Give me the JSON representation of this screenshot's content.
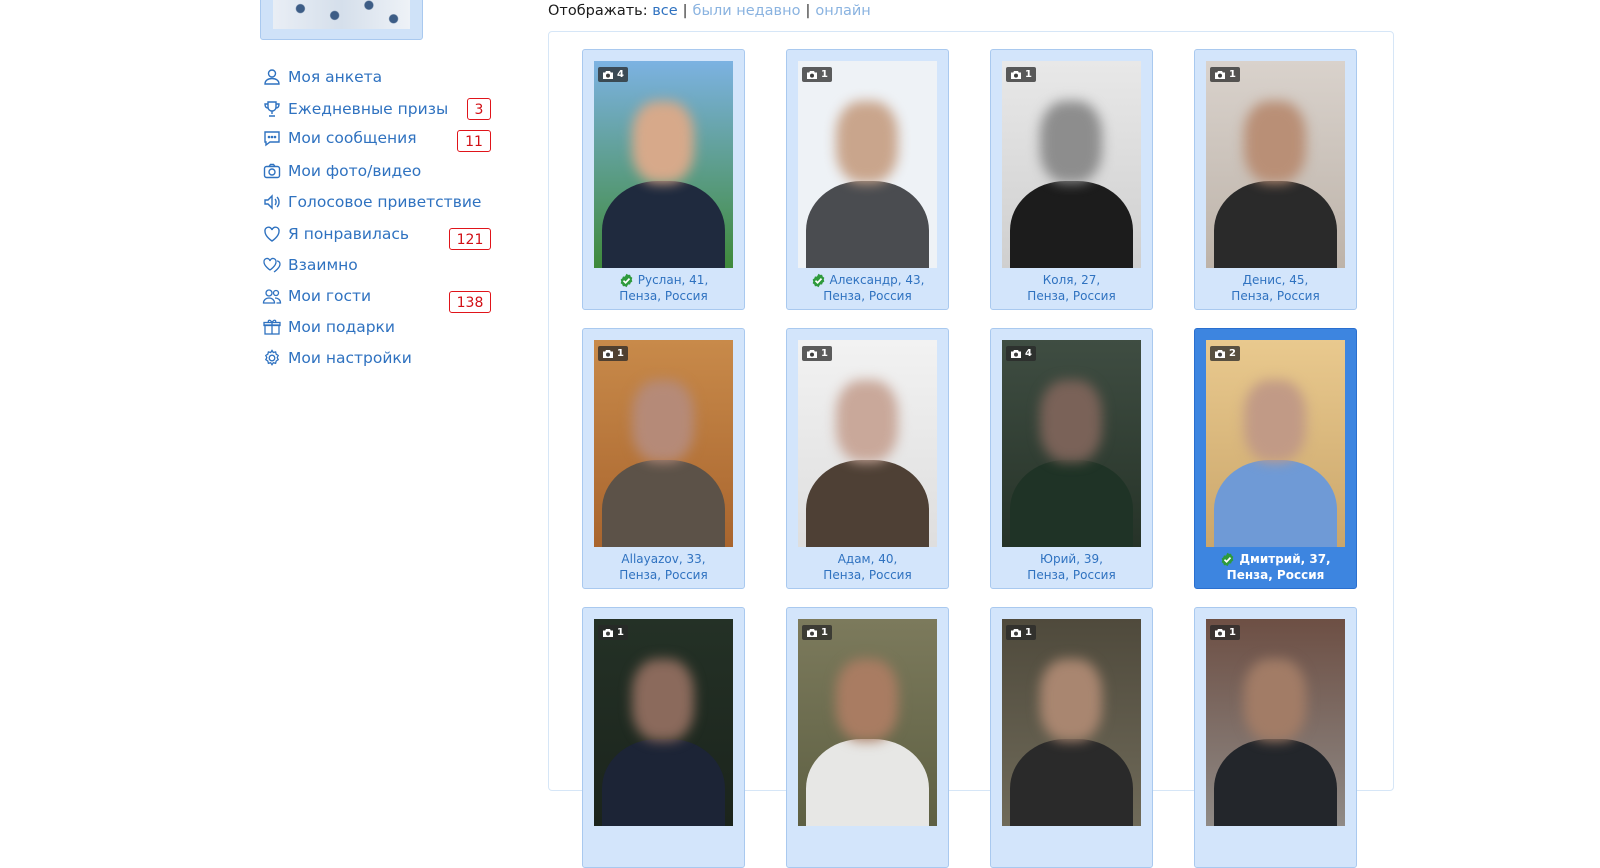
{
  "filter": {
    "label": "Отображать:",
    "options": [
      {
        "label": "все",
        "active": true
      },
      {
        "label": "были недавно",
        "active": false
      },
      {
        "label": "онлайн",
        "active": false
      }
    ]
  },
  "sidebar": {
    "items": [
      {
        "label": "Моя анкета",
        "icon": "user-icon",
        "badge": ""
      },
      {
        "label": "Ежедневные призы",
        "icon": "trophy-icon",
        "badge": "3"
      },
      {
        "label": "Мои сообщения",
        "icon": "chat-icon",
        "badge": "11"
      },
      {
        "label": "Мои фото/видео",
        "icon": "camera-icon",
        "badge": ""
      },
      {
        "label": "Голосовое приветствие",
        "icon": "speaker-icon",
        "badge": ""
      },
      {
        "label": "Я понравилась",
        "icon": "heart-icon",
        "badge": "121"
      },
      {
        "label": "Взаимно",
        "icon": "mutual-hearts-icon",
        "badge": ""
      },
      {
        "label": "Мои гости",
        "icon": "guests-icon",
        "badge": "138"
      },
      {
        "label": "Мои подарки",
        "icon": "gift-icon",
        "badge": ""
      },
      {
        "label": "Мои настройки",
        "icon": "settings-icon",
        "badge": ""
      }
    ]
  },
  "profiles": [
    {
      "name_age": "Руслан, 41,",
      "location": "Пенза, Россия",
      "photos": "4",
      "verified": true,
      "selected": false
    },
    {
      "name_age": "Александр, 43,",
      "location": "Пенза, Россия",
      "photos": "1",
      "verified": true,
      "selected": false
    },
    {
      "name_age": "Коля, 27,",
      "location": "Пенза, Россия",
      "photos": "1",
      "verified": false,
      "selected": false
    },
    {
      "name_age": "Денис, 45,",
      "location": "Пенза, Россия",
      "photos": "1",
      "verified": false,
      "selected": false
    },
    {
      "name_age": "Allayazov, 33,",
      "location": "Пенза, Россия",
      "photos": "1",
      "verified": false,
      "selected": false
    },
    {
      "name_age": "Адам, 40,",
      "location": "Пенза, Россия",
      "photos": "1",
      "verified": false,
      "selected": false
    },
    {
      "name_age": "Юрий, 39,",
      "location": "Пенза, Россия",
      "photos": "4",
      "verified": false,
      "selected": false
    },
    {
      "name_age": "Дмитрий, 37,",
      "location": "Пенза, Россия",
      "photos": "2",
      "verified": true,
      "selected": true
    },
    {
      "name_age": "",
      "location": "",
      "photos": "1",
      "verified": false,
      "selected": false
    },
    {
      "name_age": "",
      "location": "",
      "photos": "1",
      "verified": false,
      "selected": false
    },
    {
      "name_age": "",
      "location": "",
      "photos": "1",
      "verified": false,
      "selected": false
    },
    {
      "name_age": "",
      "location": "",
      "photos": "1",
      "verified": false,
      "selected": false
    }
  ],
  "colors": {
    "link": "#2f72c0",
    "badge_border": "#e0141a",
    "card_bg": "#d3e5fb",
    "card_selected_bg": "#3d85e0",
    "verified": "#2e9a3c"
  }
}
